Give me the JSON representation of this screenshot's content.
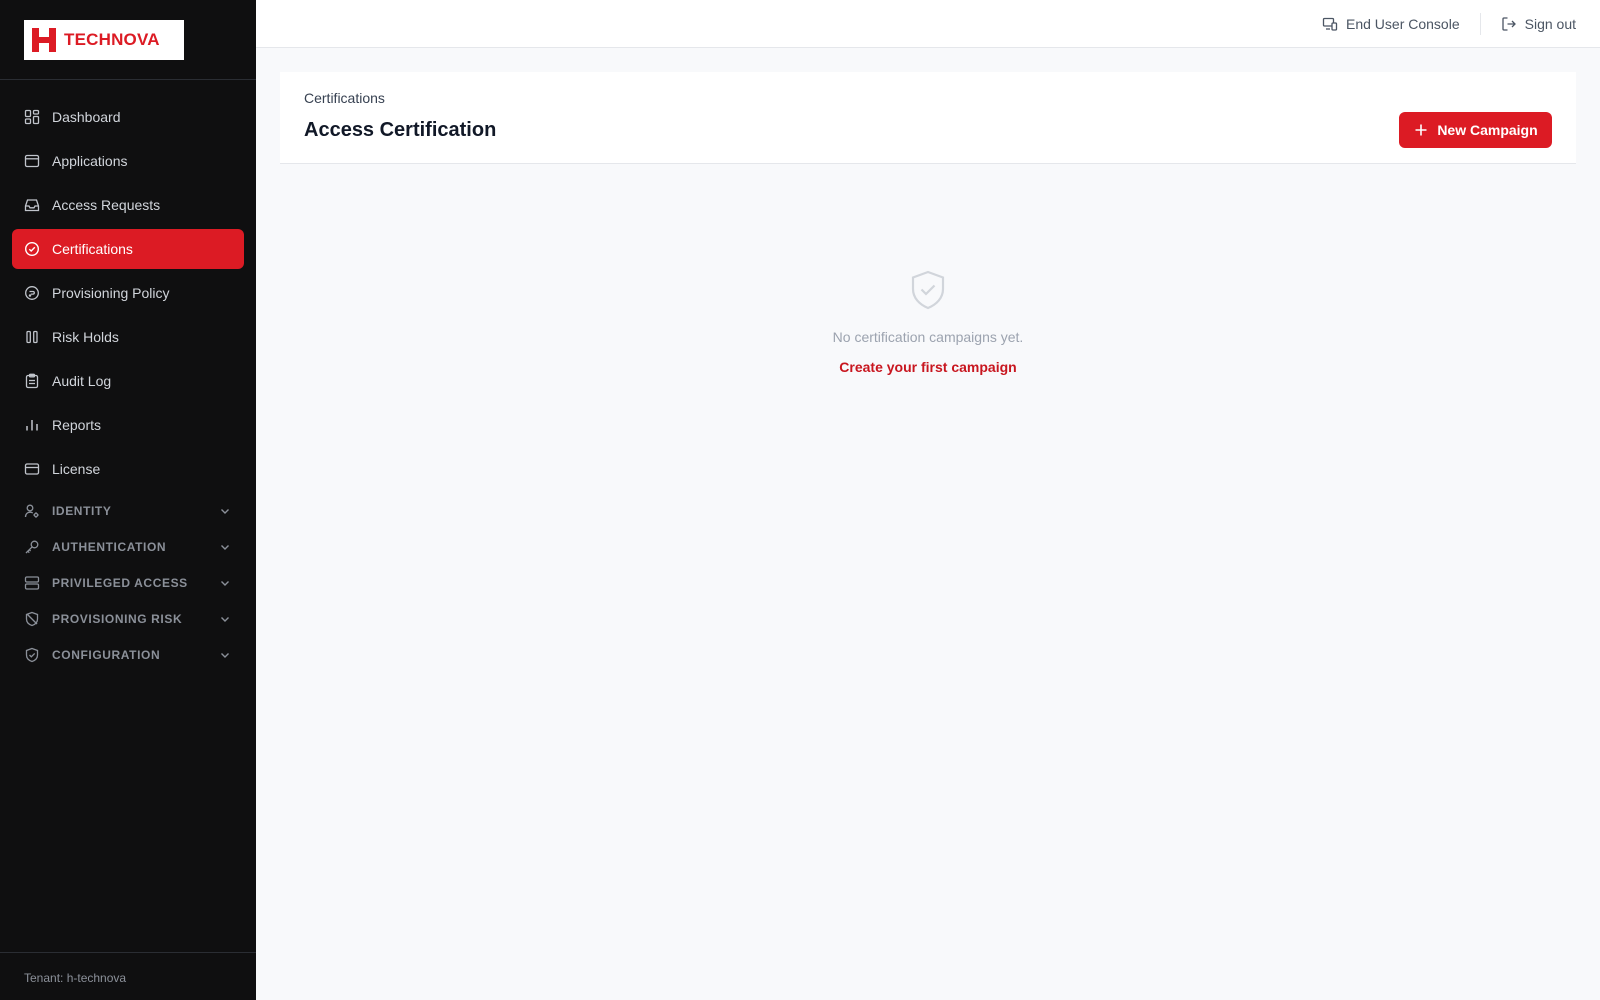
{
  "brand": {
    "name": "TECHNOVA",
    "accent": "#dc1b24"
  },
  "sidebar": {
    "items": [
      {
        "label": "Dashboard",
        "icon": "dashboard-icon"
      },
      {
        "label": "Applications",
        "icon": "window-icon"
      },
      {
        "label": "Access Requests",
        "icon": "inbox-icon"
      },
      {
        "label": "Certifications",
        "icon": "check-circle-icon",
        "active": true
      },
      {
        "label": "Provisioning Policy",
        "icon": "policy-icon"
      },
      {
        "label": "Risk Holds",
        "icon": "pause-icon"
      },
      {
        "label": "Audit Log",
        "icon": "clipboard-icon"
      },
      {
        "label": "Reports",
        "icon": "bar-chart-icon"
      },
      {
        "label": "License",
        "icon": "credit-card-icon"
      }
    ],
    "groups": [
      {
        "label": "IDENTITY",
        "icon": "user-gear-icon"
      },
      {
        "label": "AUTHENTICATION",
        "icon": "key-icon"
      },
      {
        "label": "PRIVILEGED ACCESS",
        "icon": "server-icon"
      },
      {
        "label": "PROVISIONING RISK",
        "icon": "shield-off-icon"
      },
      {
        "label": "CONFIGURATION",
        "icon": "shield-check-icon"
      }
    ],
    "tenant": "Tenant: h-technova"
  },
  "topbar": {
    "end_user_console": "End User Console",
    "sign_out": "Sign out"
  },
  "page": {
    "breadcrumb": "Certifications",
    "title": "Access Certification",
    "new_campaign": "New Campaign"
  },
  "empty_state": {
    "message": "No certification campaigns yet.",
    "link": "Create your first campaign"
  }
}
